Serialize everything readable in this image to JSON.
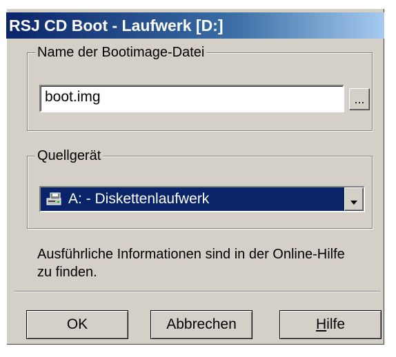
{
  "window": {
    "title": "RSJ CD Boot - Laufwerk [D:]"
  },
  "bootimage_group": {
    "legend": "Name der Bootimage-Datei",
    "filename_value": "boot.img",
    "browse_label": "..."
  },
  "source_group": {
    "legend": "Quellgerät",
    "selected_device": "A: - Diskettenlaufwerk",
    "device_icon": "floppy-drive-icon"
  },
  "info_text_line1": "Ausführliche Informationen sind in der Online-Hilfe",
  "info_text_line2": "zu finden.",
  "buttons": {
    "ok_label": "OK",
    "cancel_label": "Abbrechen",
    "help_label": "Hilfe"
  },
  "colors": {
    "dialog_bg": "#d4d0c8",
    "title_bar": "#0a246a",
    "selection": "#0a246a"
  }
}
